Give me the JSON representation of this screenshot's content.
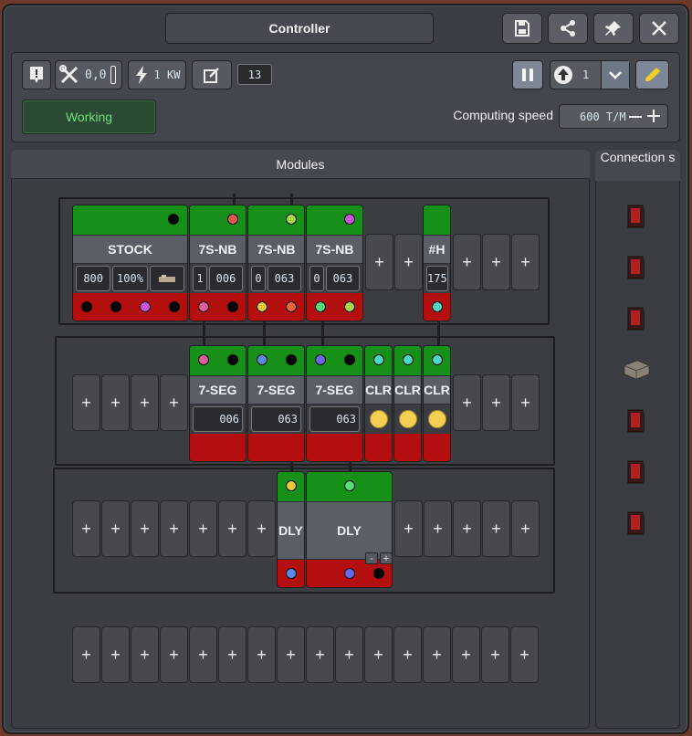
{
  "window": {
    "title": "Controller"
  },
  "title_buttons": {
    "save": "save-icon",
    "share": "share-icon",
    "pin": "pin-icon",
    "close": "close-icon"
  },
  "toolbar": {
    "info_icon": "info-icon",
    "tools_value": "0,0",
    "power_value": "1 KW",
    "edit_icon": "edit-icon",
    "counter_value": "13",
    "pause_icon": "pause-icon",
    "rotation_value": "1",
    "highlight_icon": "highlight-icon"
  },
  "status": {
    "label": "Working",
    "color": "#6fe07a"
  },
  "speed": {
    "label": "Computing speed",
    "value": "600 T/M"
  },
  "modules_panel": {
    "title": "Modules"
  },
  "connections_panel": {
    "title": "Connection\ns"
  },
  "row1": {
    "stock": {
      "name": "STOCK",
      "qty": "800",
      "pct": "100%"
    },
    "nb1": {
      "name": "7S-NB",
      "a": "1",
      "b": "006"
    },
    "nb2": {
      "name": "7S-NB",
      "a": "0",
      "b": "063"
    },
    "nb3": {
      "name": "7S-NB",
      "a": "0",
      "b": "063"
    },
    "hash": {
      "name": "#H",
      "v": "175"
    }
  },
  "row2": {
    "seg1": {
      "name": "7-SEG",
      "v": "006"
    },
    "seg2": {
      "name": "7-SEG",
      "v": "063"
    },
    "seg3": {
      "name": "7-SEG",
      "v": "063"
    },
    "clr1": {
      "name": "CLR"
    },
    "clr2": {
      "name": "CLR"
    },
    "clr3": {
      "name": "CLR"
    }
  },
  "row3": {
    "dly1": {
      "name": "DLY"
    },
    "dly2": {
      "name": "DLY",
      "minus": "-",
      "plus": "+"
    }
  },
  "add_slot_label": "+",
  "colors": {
    "green": "#169018",
    "red": "#b30f0f",
    "accent": "#f0d020"
  }
}
